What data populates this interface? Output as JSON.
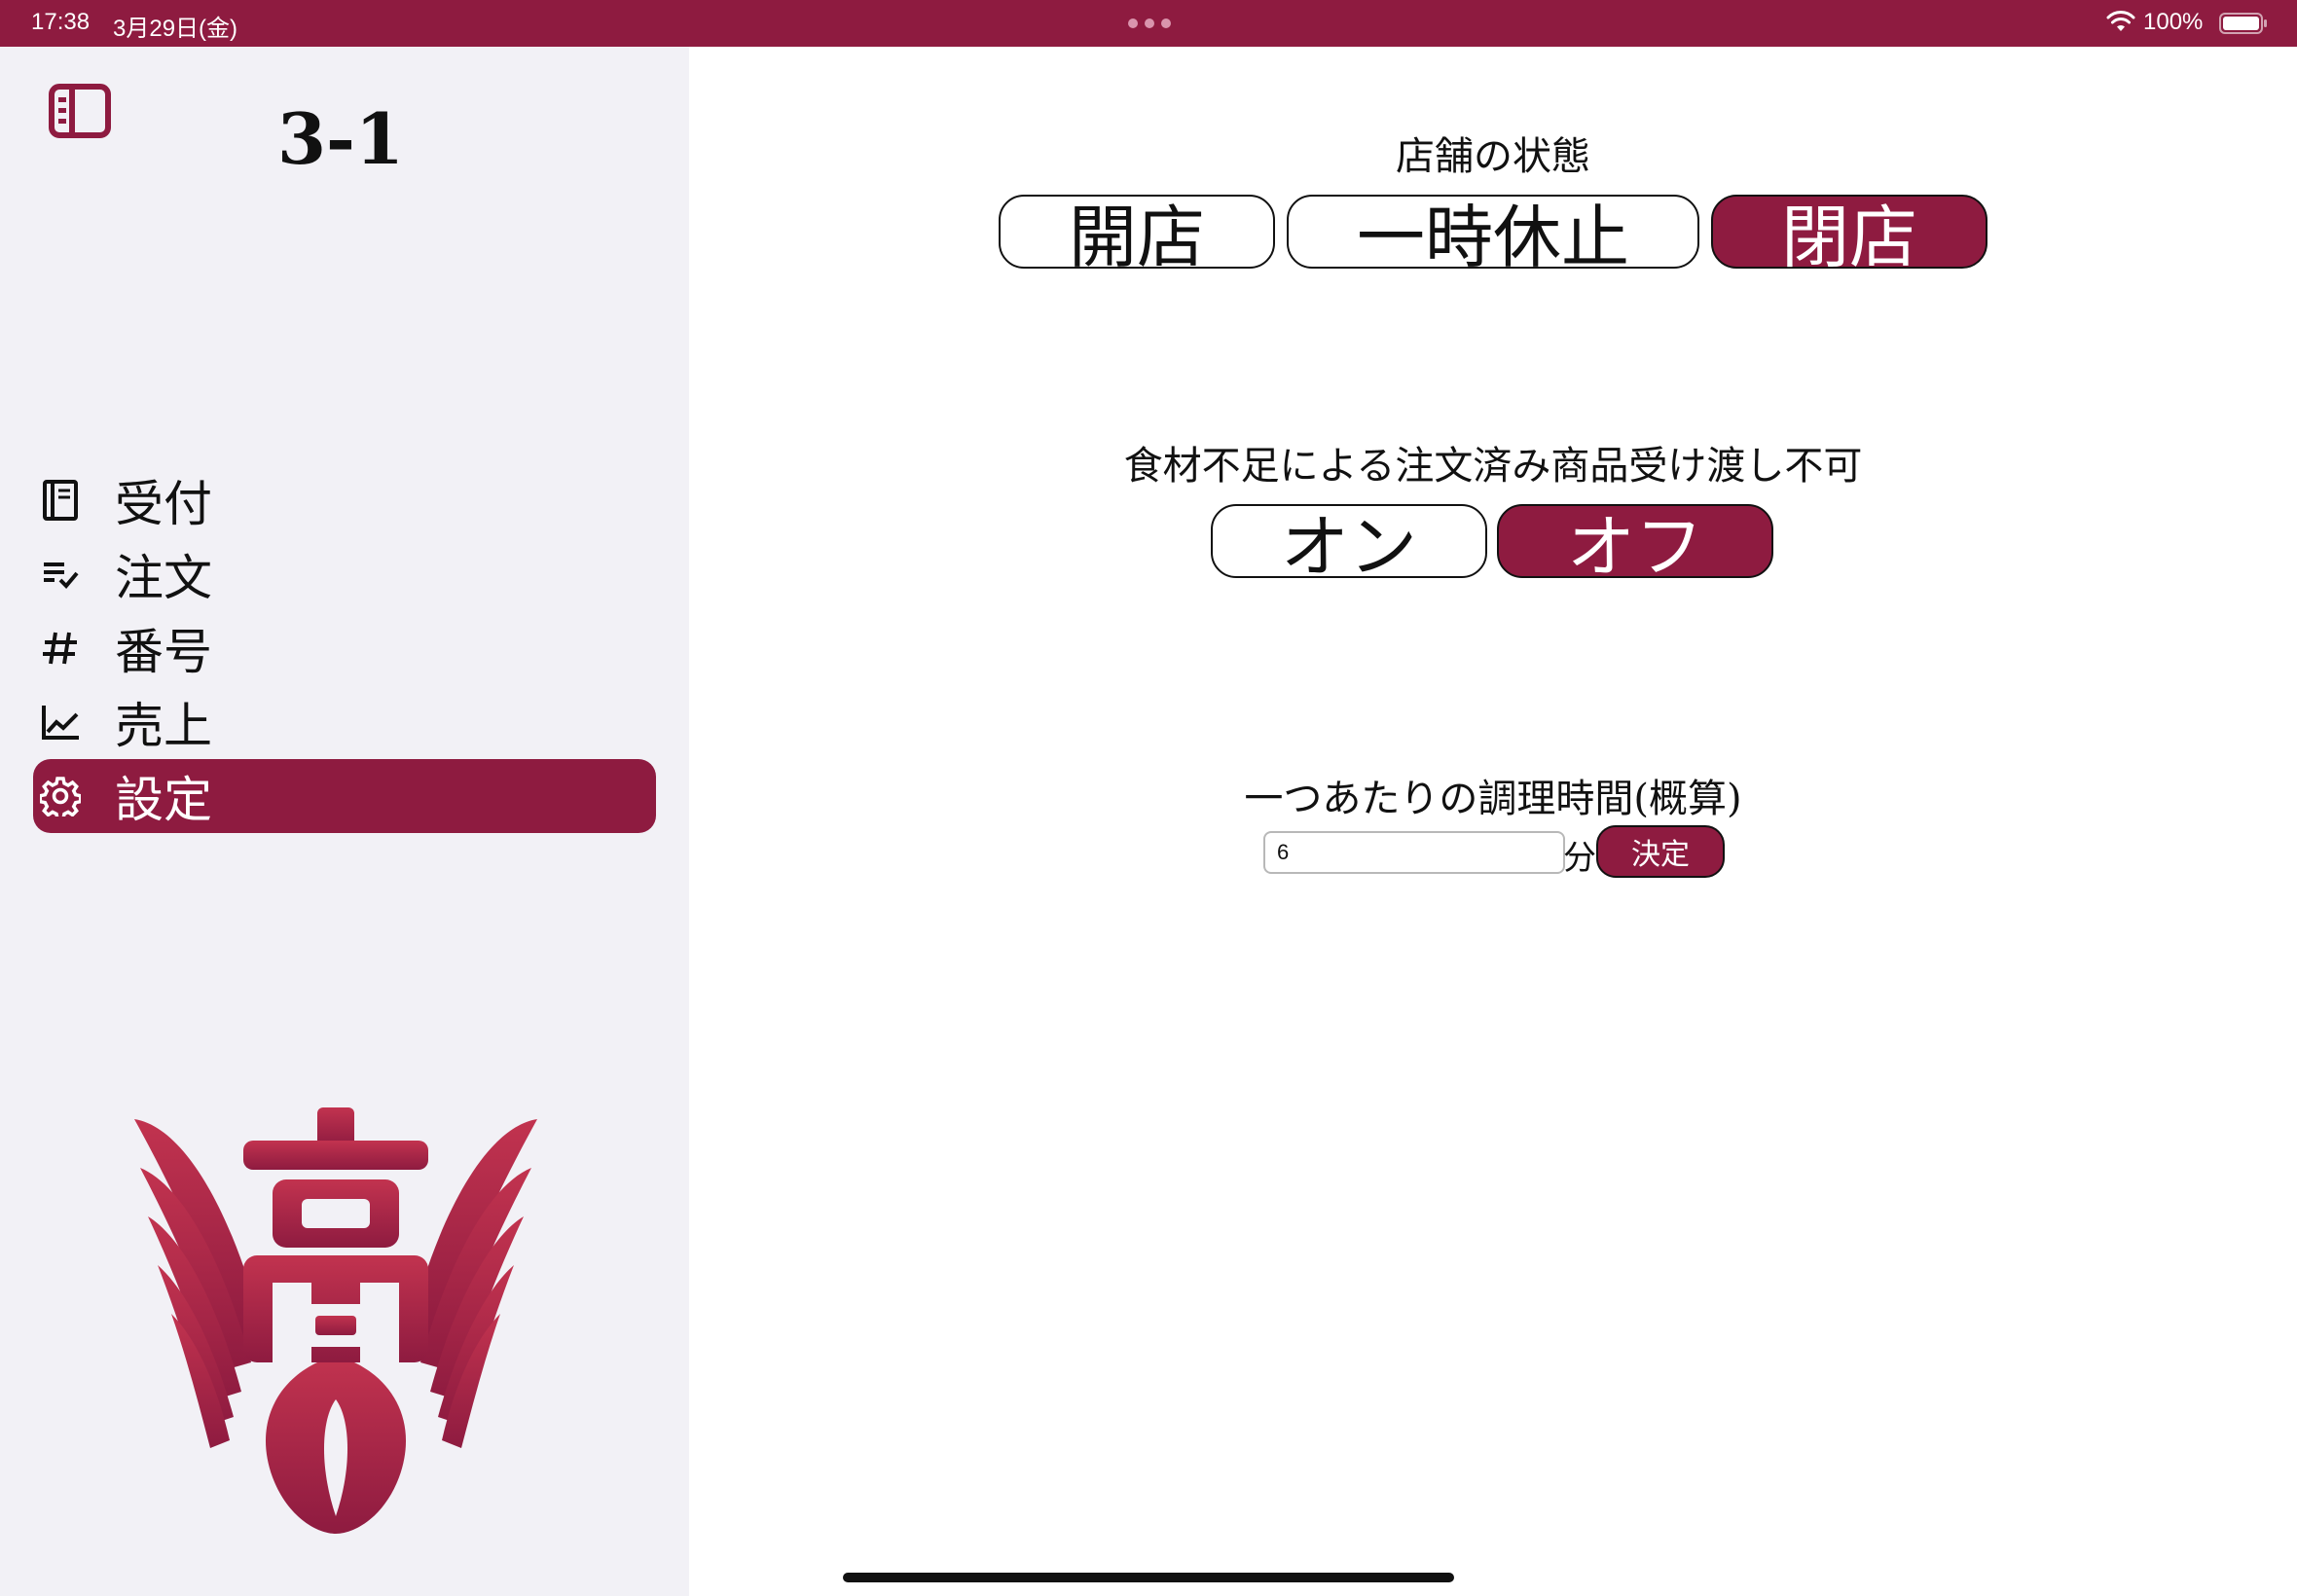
{
  "status_bar": {
    "time": "17:38",
    "date": "3月29日(金)",
    "battery": "100%",
    "color": "#8e1b40"
  },
  "sidebar": {
    "title": "3-1",
    "toggle_icon": "sidebar-toggle-icon",
    "items": [
      {
        "label": "受付",
        "icon": "book-icon",
        "active": false
      },
      {
        "label": "注文",
        "icon": "list-check-icon",
        "active": false
      },
      {
        "label": "番号",
        "icon": "hash-icon",
        "active": false
      },
      {
        "label": "売上",
        "icon": "line-chart-icon",
        "active": false
      },
      {
        "label": "設定",
        "icon": "gear-icon",
        "active": true
      }
    ],
    "logo": "school-crest-logo"
  },
  "main": {
    "store_status": {
      "label": "店舗の状態",
      "options": [
        "開店",
        "一時休止",
        "閉店"
      ],
      "selected": "閉店"
    },
    "shortage": {
      "label": "食材不足による注文済み商品受け渡し不可",
      "options": [
        "オン",
        "オフ"
      ],
      "selected": "オフ"
    },
    "cook_time": {
      "label": "一つあたりの調理時間(概算)",
      "value": "6",
      "unit": "分",
      "submit_label": "決定"
    }
  },
  "theme": {
    "accent": "#8e1b40",
    "sidebar_bg": "#f2f1f6"
  }
}
